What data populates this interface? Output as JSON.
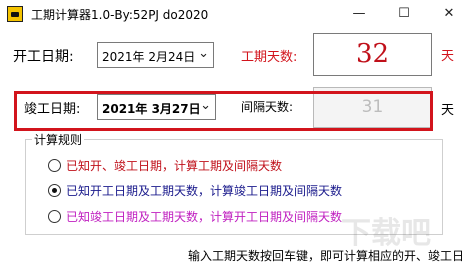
{
  "window": {
    "title": "工期计算器1.0-By:52PJ do2020",
    "minimize": "—",
    "maximize": "☐",
    "close": "✕"
  },
  "start": {
    "label": "开工日期:",
    "value": "2021年  2月24日"
  },
  "days": {
    "label": "工期天数:",
    "value": "32",
    "unit": "天",
    "label_color": "#d2141c",
    "value_color": "#c0101a"
  },
  "end": {
    "label": "竣工日期:",
    "value": "2021年  3月27日"
  },
  "interval": {
    "label": "间隔天数:",
    "value": "31",
    "unit": "天"
  },
  "rules": {
    "title": "计算规则",
    "options": [
      {
        "text": "已知开、竣工日期，计算工期及间隔天数",
        "selected": false,
        "color": "#c0101a"
      },
      {
        "text": "已知开工日期及工期天数，计算竣工日期及间隔天数",
        "selected": true,
        "color": "#1a1a8c"
      },
      {
        "text": "已知竣工日期及工期天数，计算开工日期及间隔天数",
        "selected": false,
        "color": "#c020c0"
      }
    ]
  },
  "hint": "输入工期天数按回车键，即可计算相应的开、竣工日",
  "watermark": "下载吧",
  "highlight_color": "#d2141c"
}
